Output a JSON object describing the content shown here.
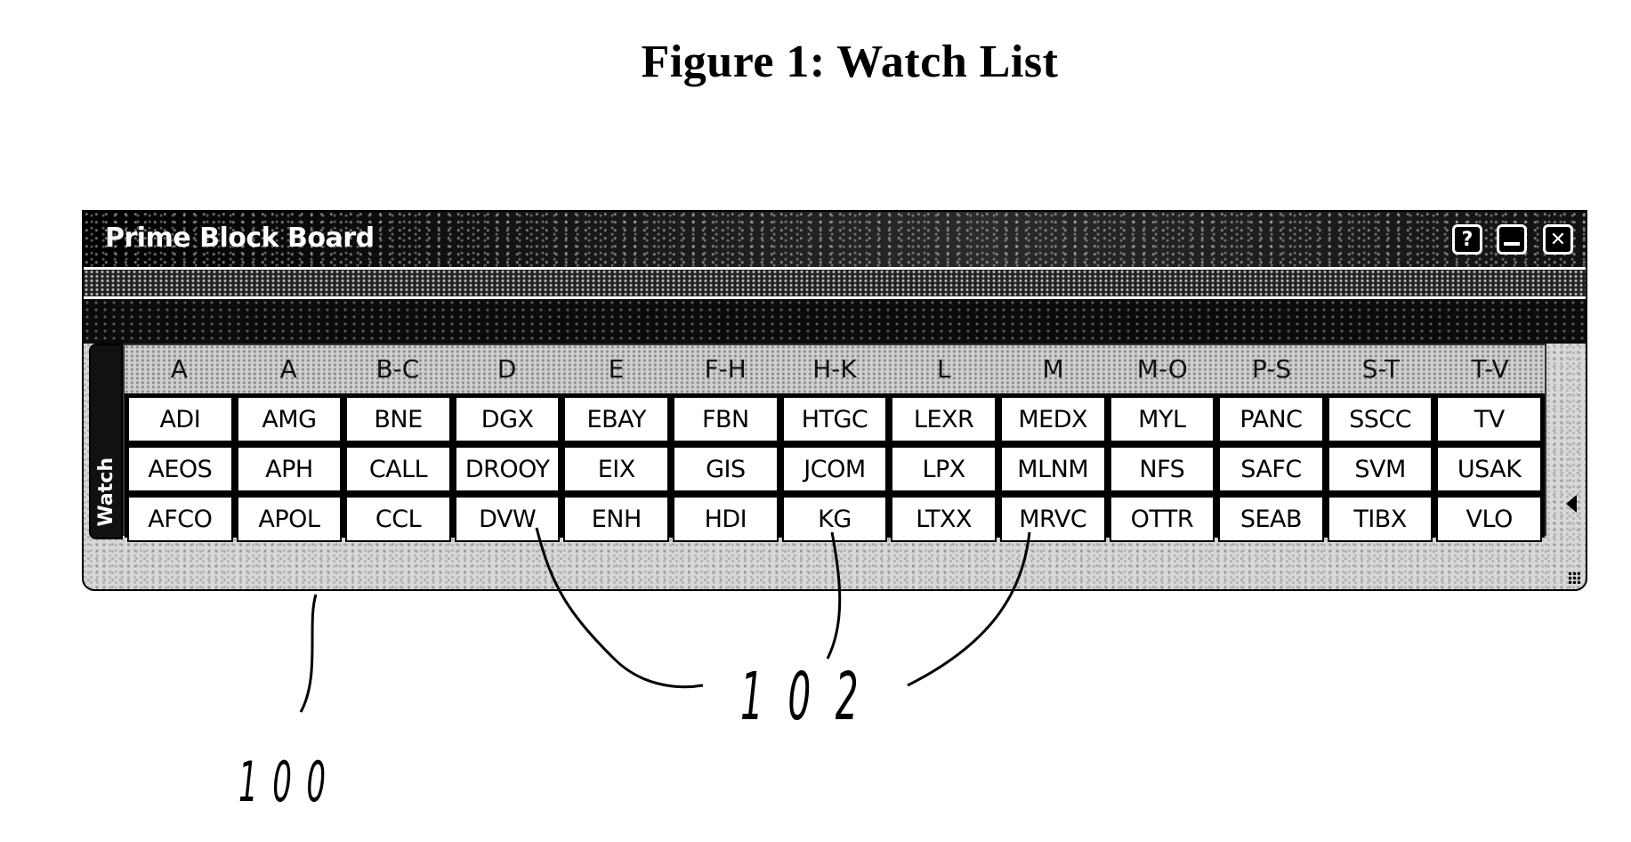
{
  "figure": {
    "title": "Figure 1: Watch List"
  },
  "window": {
    "title": "Prime Block Board",
    "buttons": {
      "help_icon": "?",
      "minimize_icon": "minimize",
      "close_icon": "✕"
    },
    "side_tab_label": "Watch"
  },
  "watch_list": {
    "column_headers": [
      "A",
      "A",
      "B-C",
      "D",
      "E",
      "F-H",
      "H-K",
      "L",
      "M",
      "M-O",
      "P-S",
      "S-T",
      "T-V"
    ],
    "rows": [
      [
        "ADI",
        "AMG",
        "BNE",
        "DGX",
        "EBAY",
        "FBN",
        "HTGC",
        "LEXR",
        "MEDX",
        "MYL",
        "PANC",
        "SSCC",
        "TV"
      ],
      [
        "AEOS",
        "APH",
        "CALL",
        "DROOY",
        "EIX",
        "GIS",
        "JCOM",
        "LPX",
        "MLNM",
        "NFS",
        "SAFC",
        "SVM",
        "USAK"
      ],
      [
        "AFCO",
        "APOL",
        "CCL",
        "DVW",
        "ENH",
        "HDI",
        "KG",
        "LTXX",
        "MRVC",
        "OTTR",
        "SEAB",
        "TIBX",
        "VLO"
      ]
    ]
  },
  "annotations": {
    "window_ref": "100",
    "button_ref": "102"
  }
}
